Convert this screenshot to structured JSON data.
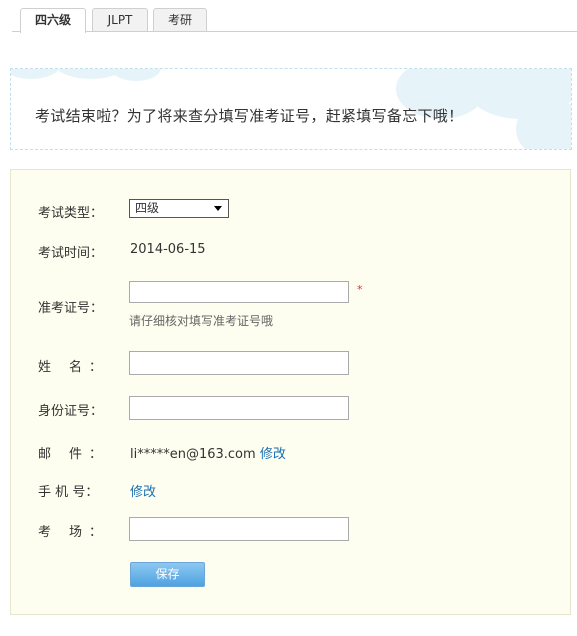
{
  "tabs": [
    {
      "label": "四六级",
      "active": true
    },
    {
      "label": "JLPT",
      "active": false
    },
    {
      "label": "考研",
      "active": false
    }
  ],
  "banner": {
    "text": "考试结束啦？为了将来查分填写准考证号，赶紧填写备忘下哦！"
  },
  "form": {
    "exam_type": {
      "label": "考试类型：",
      "selected": "四级"
    },
    "exam_time": {
      "label": "考试时间：",
      "value": "2014-06-15"
    },
    "ticket_no": {
      "label": "准考证号：",
      "value": "",
      "required_mark": "*",
      "hint": "请仔细核对填写准考证号哦"
    },
    "name": {
      "label_a": "姓",
      "label_b": "名：",
      "value": ""
    },
    "id_no": {
      "label": "身份证号：",
      "value": ""
    },
    "email": {
      "label_a": "邮",
      "label_b": "件：",
      "value": "li*****en@163.com",
      "edit": "修改"
    },
    "phone": {
      "label_a": "手",
      "label_b": "机",
      "label_c": "号：",
      "edit": "修改"
    },
    "venue": {
      "label_a": "考",
      "label_b": "场：",
      "value": ""
    },
    "save": "保存"
  },
  "colors": {
    "panel_bg": "#fdfeef",
    "link": "#1a6fb5",
    "button": "#4fa2e1",
    "required": "#d33333"
  }
}
